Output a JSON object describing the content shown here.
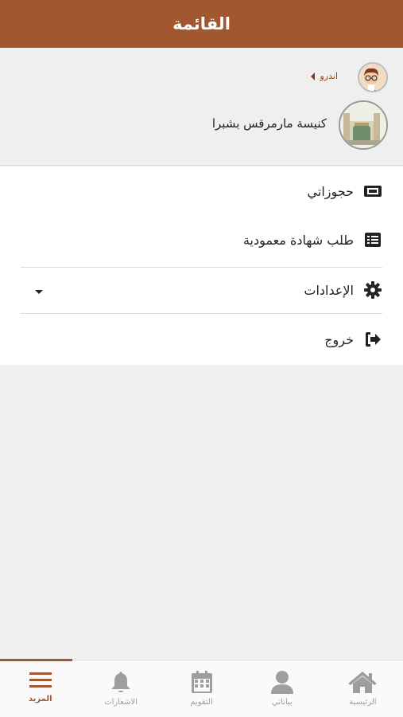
{
  "header": {
    "title": "القائمة"
  },
  "profile": {
    "user_name": "اندرو",
    "church_name": "كنيسة مارمرقس بشبرا"
  },
  "menu": {
    "items": [
      {
        "label": "حجوزاتي",
        "icon": "ticket-icon"
      },
      {
        "label": "طلب شهادة معمودية",
        "icon": "list-icon"
      },
      {
        "label": "الإعدادات",
        "icon": "gear-icon"
      },
      {
        "label": "خروج",
        "icon": "sign-out-icon"
      }
    ]
  },
  "bottom_nav": {
    "items": [
      {
        "label": "المزيد",
        "icon": "hamburger-menu-icon",
        "active": true
      },
      {
        "label": "الاشعارات",
        "icon": "bell-icon",
        "active": false
      },
      {
        "label": "التقويم",
        "icon": "calendar-icon",
        "active": false
      },
      {
        "label": "بياناتي",
        "icon": "user-icon",
        "active": false
      },
      {
        "label": "الرئيسية",
        "icon": "home-icon",
        "active": false
      }
    ]
  },
  "colors": {
    "brand": "#a15830",
    "background": "#efefef",
    "inactive": "#9e9e9e"
  }
}
